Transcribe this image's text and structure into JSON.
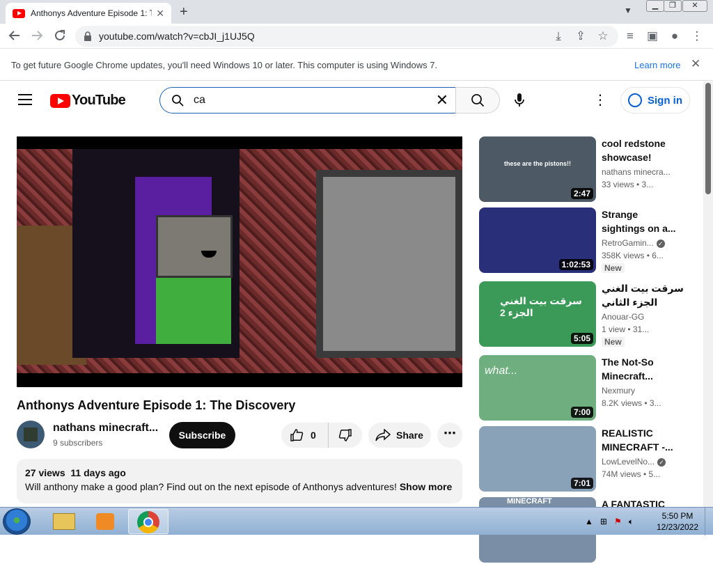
{
  "browser": {
    "tab_title": "Anthonys Adventure Episode 1: T",
    "url": "youtube.com/watch?v=cbJI_j1UJ5Q",
    "infobar_message": "To get future Google Chrome updates, you'll need Windows 10 or later. This computer is using Windows 7.",
    "infobar_link": "Learn more"
  },
  "youtube": {
    "logo_text": "YouTube",
    "search_query": "ca",
    "signin_label": "Sign in"
  },
  "video": {
    "title": "Anthonys Adventure Episode 1: The Discovery",
    "channel": "nathans minecraft...",
    "subscribers": "9 subscribers",
    "subscribe_label": "Subscribe",
    "likes": "0",
    "share_label": "Share",
    "views": "27 views",
    "date": "11 days ago",
    "description": "Will anthony make a good plan? Find out on the next episode of Anthonys adventures!",
    "show_more": "Show more"
  },
  "recommendations": [
    {
      "title": "cool redstone showcase!",
      "channel": "nathans minecra...",
      "meta": "33 views • 3...",
      "duration": "2:47",
      "overlay": "these are the pistons!!",
      "verified": false,
      "badge": "",
      "thumb_color": "#4d5a66"
    },
    {
      "title": "Strange sightings on a...",
      "channel": "RetroGamin...",
      "meta": "358K views • 6...",
      "duration": "1:02:53",
      "overlay": "",
      "verified": true,
      "badge": "New",
      "thumb_color": "#2a2f7a"
    },
    {
      "title": "سرقت بيت الغني الجزء الثاني",
      "channel": "Anouar-GG",
      "meta": "1 view • 31...",
      "duration": "5:05",
      "overlay": "سرقت بيت الغني الجزء 2",
      "verified": false,
      "badge": "New",
      "thumb_color": "#3c9a58"
    },
    {
      "title": "The Not-So Minecraft...",
      "channel": "Nexmury",
      "meta": "8.2K views • 3...",
      "duration": "7:00",
      "overlay": "what...",
      "verified": false,
      "badge": "",
      "thumb_color": "#6fae7f"
    },
    {
      "title": "REALISTIC MINECRAFT -...",
      "channel": "LowLevelNo...",
      "meta": "74M views • 5...",
      "duration": "7:01",
      "overlay": "",
      "verified": true,
      "badge": "",
      "thumb_color": "#8aa2b8"
    },
    {
      "title": "A FANTASTIC",
      "channel": "",
      "meta": "",
      "duration": "",
      "overlay": "MINECRAFT",
      "verified": false,
      "badge": "",
      "thumb_color": "#7a8ea5"
    }
  ],
  "taskbar": {
    "time": "5:50 PM",
    "date": "12/23/2022"
  }
}
